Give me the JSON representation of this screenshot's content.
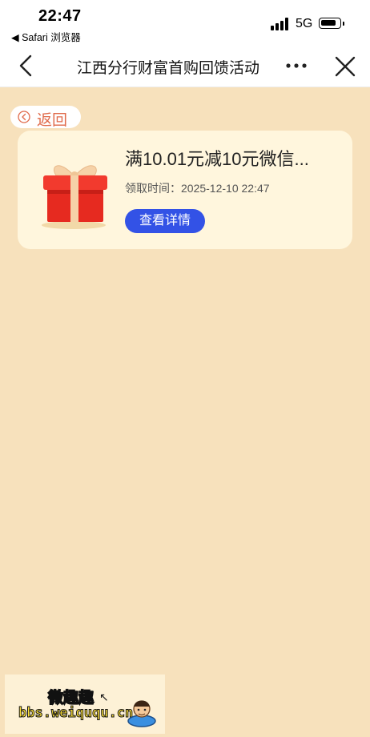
{
  "status_bar": {
    "time": "22:47",
    "back_app": "◀ Safari 浏览器",
    "network": "5G",
    "icons": [
      "signal-icon",
      "battery-icon"
    ]
  },
  "nav": {
    "title": "江西分行财富首购回馈活动",
    "icons": [
      "back-chevron-icon",
      "more-dots-icon",
      "close-icon"
    ]
  },
  "back_button": {
    "label": "返回"
  },
  "reward_card": {
    "title": "满10.01元减10元微信...",
    "claim_label": "领取时间：",
    "claim_time": "2025-12-10 22:47",
    "detail_button": "查看详情",
    "icon": "gift-box-icon"
  },
  "watermark": {
    "title": "微趣趣",
    "url": "bbs.weiququ.cn"
  },
  "colors": {
    "page_background": "#f7e1bc",
    "card_background": "#fff6dd",
    "accent_blue": "#3352e6",
    "back_text": "#e06a4a"
  }
}
